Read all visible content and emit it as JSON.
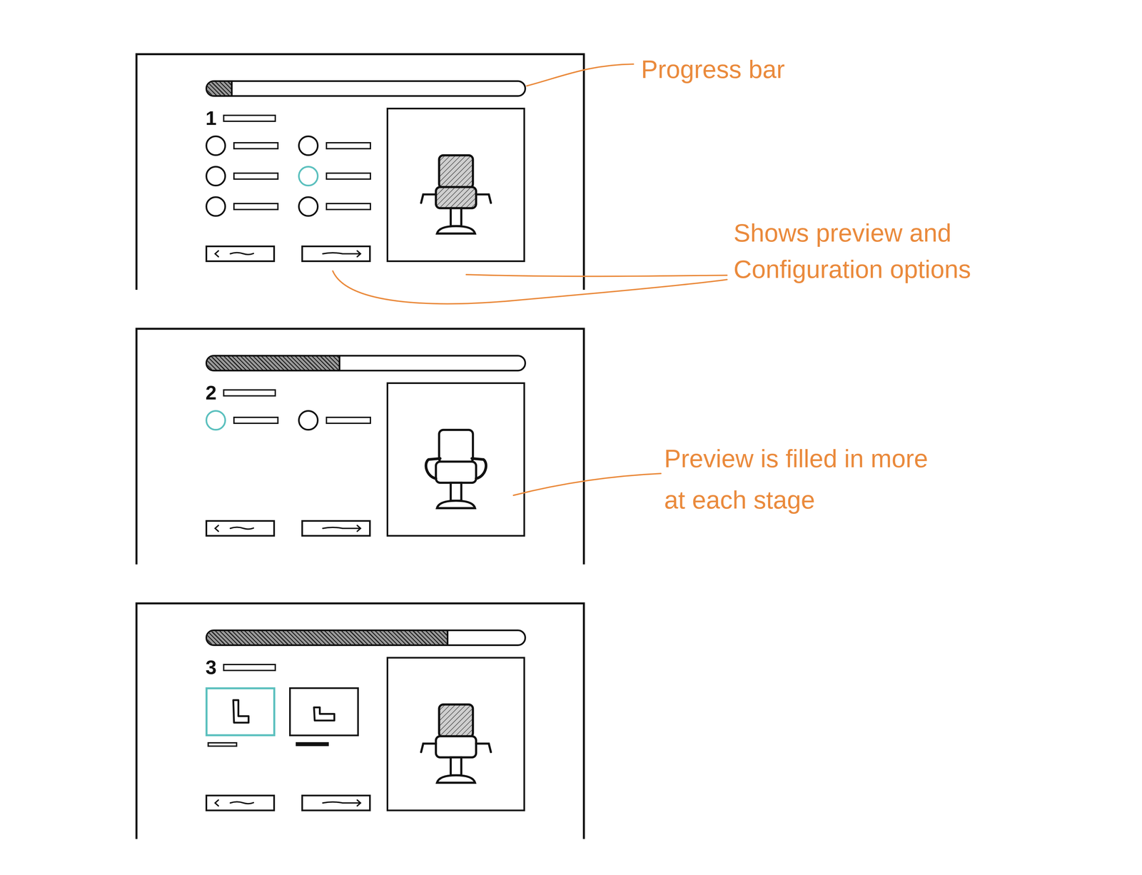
{
  "annotations": [
    {
      "lines": [
        "Progress bar"
      ]
    },
    {
      "lines": [
        "Shows preview and",
        "Configuration options"
      ]
    },
    {
      "lines": [
        "Preview is filled in more",
        "at each stage"
      ]
    }
  ],
  "steps": [
    {
      "number": "1",
      "level": 0.08,
      "kind": "radio",
      "highlight": "seat",
      "options": [
        {
          "selected": false
        },
        {
          "selected": false
        },
        {
          "selected": false
        },
        {
          "selected": true
        },
        {
          "selected": false
        },
        {
          "selected": false
        }
      ]
    },
    {
      "number": "2",
      "level": 0.42,
      "kind": "radio",
      "highlight": "arms",
      "options": [
        {
          "selected": true
        },
        {
          "selected": false
        }
      ]
    },
    {
      "number": "3",
      "level": 0.76,
      "kind": "card",
      "highlight": "back",
      "options": [
        {
          "selected": true,
          "kind": "high-back"
        },
        {
          "selected": false,
          "kind": "low-back"
        }
      ]
    }
  ]
}
